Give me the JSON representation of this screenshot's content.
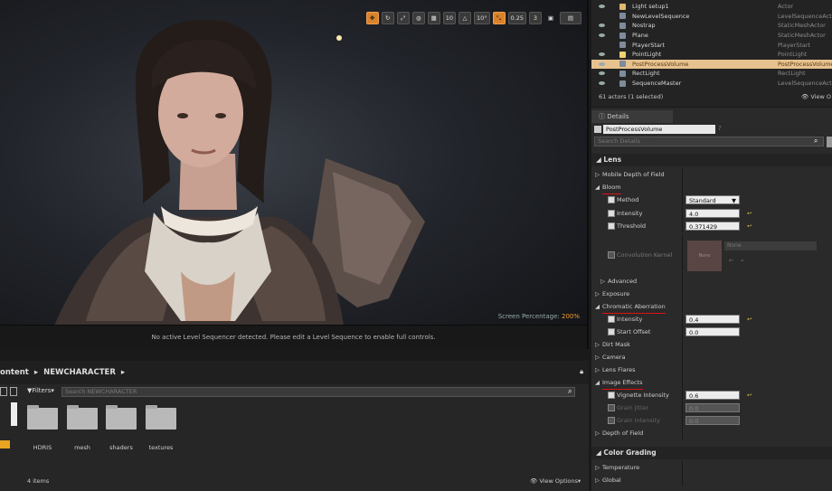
{
  "viewport": {
    "toolbar": {
      "grid_snap": "10",
      "rotation_snap": "10°",
      "scale_snap": "0.25",
      "camera_speed": "3"
    },
    "screen_percentage_label": "Screen Percentage:",
    "screen_percentage_value": "200%",
    "sequencer_notice": "No active Level Sequencer detected. Please edit a Level Sequence to enable full controls."
  },
  "content_browser": {
    "breadcrumb_root": "ontent",
    "breadcrumb_folder": "NEWCHARACTER",
    "filters_label": "Filters",
    "search_placeholder": "Search NEWCHARACTER",
    "folders": [
      "HDRIS",
      "mesh",
      "shaders",
      "textures"
    ],
    "item_count": "4 items",
    "view_options": "View Options"
  },
  "outliner": {
    "rows": [
      {
        "name": "Light setup1",
        "type": "Actor"
      },
      {
        "name": "NewLevelSequence",
        "type": "LevelSequenceActor"
      },
      {
        "name": "Nostrap",
        "type": "StaticMeshActor"
      },
      {
        "name": "Plane",
        "type": "StaticMeshActor"
      },
      {
        "name": "PlayerStart",
        "type": "PlayerStart"
      },
      {
        "name": "PointLight",
        "type": "PointLight"
      },
      {
        "name": "PostProcessVolume",
        "type": "PostProcessVolume"
      },
      {
        "name": "RectLight",
        "type": "RectLight"
      },
      {
        "name": "SequenceMaster",
        "type": "LevelSequenceActor"
      }
    ],
    "summary": "61 actors (1 selected)",
    "view_options": "View O"
  },
  "details": {
    "tab_label": "Details",
    "object_name": "PostProcessVolume",
    "search_placeholder": "Search Details",
    "lens_section": "Lens",
    "mobile_dof": "Mobile Depth of Field",
    "bloom": "Bloom",
    "method_label": "Method",
    "method_value": "Standard",
    "intensity_label": "Intensity",
    "bloom_intensity": "4.0",
    "threshold_label": "Threshold",
    "threshold_value": "0.371429",
    "convolution_kernel": "Convolution Kernel",
    "kernel_none": "None",
    "kernel_thumb": "None",
    "advanced": "Advanced",
    "exposure": "Exposure",
    "chromatic_aberration": "Chromatic Aberration",
    "ca_intensity": "0.4",
    "start_offset_label": "Start Offset",
    "start_offset_value": "0.0",
    "dirt_mask": "Dirt Mask",
    "camera": "Camera",
    "lens_flares": "Lens Flares",
    "image_effects": "Image Effects",
    "vignette_label": "Vignette Intensity",
    "vignette_value": "0.6",
    "grain_jitter_label": "Grain Jitter",
    "grain_jitter_value": "0.0",
    "grain_intensity_label": "Grain Intensity",
    "grain_intensity_value": "0.0",
    "depth_of_field": "Depth of Field",
    "color_grading": "Color Grading",
    "temperature": "Temperature",
    "global": "Global"
  }
}
